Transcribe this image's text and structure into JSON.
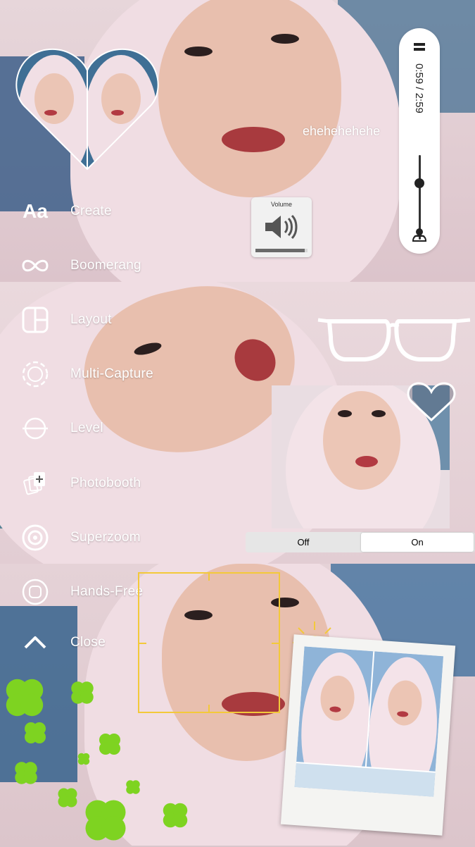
{
  "camera_menu": {
    "items": [
      {
        "label": "Create",
        "icon": "text-aa-icon"
      },
      {
        "label": "Boomerang",
        "icon": "infinity-icon"
      },
      {
        "label": "Layout",
        "icon": "layout-grid-icon"
      },
      {
        "label": "Multi-Capture",
        "icon": "dashed-circle-icon"
      },
      {
        "label": "Level",
        "icon": "level-icon"
      },
      {
        "label": "Photobooth",
        "icon": "photobooth-icon"
      },
      {
        "label": "Superzoom",
        "icon": "target-icon"
      },
      {
        "label": "Hands-Free",
        "icon": "record-button-icon"
      },
      {
        "label": "Close",
        "icon": "chevron-up-icon"
      }
    ],
    "create_glyph": "Aa"
  },
  "video_player": {
    "time": "0:59 / 2:59",
    "progress": 0.33
  },
  "caption": "ehehehehehe",
  "volume_hud": {
    "title": "Volume",
    "level": 0.95
  },
  "toggle": {
    "off_label": "Off",
    "on_label": "On",
    "selected": "On"
  },
  "colors": {
    "menu_text": "#ffffff",
    "focus_box": "#f3c93a",
    "sun": "#f5c518",
    "clover": "#7ed321"
  }
}
